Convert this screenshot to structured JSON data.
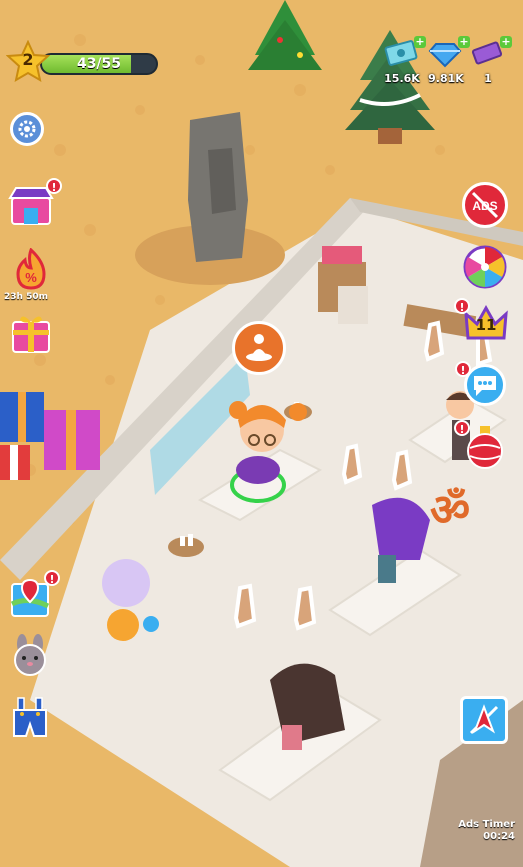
{
  "player": {
    "level": "2",
    "xp_text": "43/55",
    "xp_fraction": 0.78
  },
  "currencies": [
    {
      "name": "cash-icon",
      "value": "15.6K",
      "color": "#7fd8e8"
    },
    {
      "name": "diamond-icon",
      "value": "9.81K",
      "color": "#46a8f0"
    },
    {
      "name": "ticket-icon",
      "value": "1",
      "color": "#9a5bd6"
    }
  ],
  "side_left": {
    "special_offer_timer": "23h 50m"
  },
  "side_right": {
    "ads_label": "ADS",
    "vip_level": "11"
  },
  "ads_timer": {
    "label": "Ads Timer",
    "value": "00:24"
  },
  "colors": {
    "sand": "#e9b868",
    "floor": "#efe9e1",
    "wall": "#cfc9bf",
    "accent_orange": "#e8732b",
    "badge_red": "#e0283a",
    "xp_green": "#8ed24a"
  }
}
